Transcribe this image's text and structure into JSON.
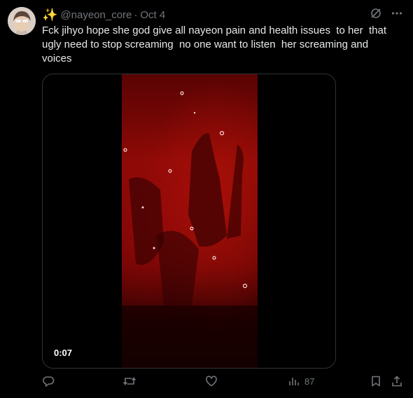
{
  "tweet": {
    "handle": "@nayeon_core",
    "separator": "·",
    "date": "Oct 4",
    "text": "Fck jihyo hope she god give all nayeon pain and health issues  to her  that ugly need to stop screaming  no one want to listen  her screaming and voices",
    "sparkle_icon": "sparkles-icon"
  },
  "media": {
    "timecode": "0:07"
  },
  "actions": {
    "views_count": "87"
  },
  "colors": {
    "background": "#000000",
    "text": "#e7e9ea",
    "muted": "#71767b",
    "border": "#2f3336",
    "video_red": "#8a0a06"
  }
}
